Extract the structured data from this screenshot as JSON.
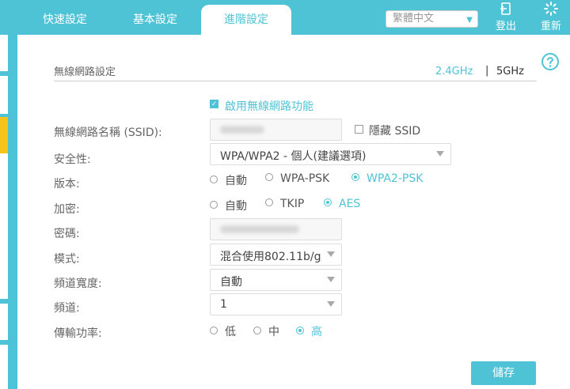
{
  "nav": {
    "tabs": [
      "快速設定",
      "基本設定",
      "進階設定"
    ],
    "language": "繁體中文",
    "logout": "登出",
    "reboot": "重新"
  },
  "section": {
    "title": "無線網路設定",
    "band_24": "2.4GHz",
    "band_sep": "|",
    "band_5": "5GHz"
  },
  "form": {
    "enable_wireless": "啟用無線網路功能",
    "ssid_label": "無線網路名稱 (SSID):",
    "hide_ssid": "隱藏 SSID",
    "security_label": "安全性:",
    "security_value": "WPA/WPA2 - 個人(建議選項)",
    "version_label": "版本:",
    "version_options": [
      "自動",
      "WPA-PSK",
      "WPA2-PSK"
    ],
    "encryption_label": "加密:",
    "encryption_options": [
      "自動",
      "TKIP",
      "AES"
    ],
    "password_label": "密碼:",
    "mode_label": "模式:",
    "mode_value": "混合使用802.11b/g/n",
    "bandwidth_label": "頻道寬度:",
    "bandwidth_value": "自動",
    "channel_label": "頻道:",
    "channel_value": "1",
    "power_label": "傳輸功率:",
    "power_options": [
      "低",
      "中",
      "高"
    ],
    "save": "儲存"
  },
  "colors": {
    "accent": "#4ec3d6",
    "sidebar_highlight": "#f6c318"
  },
  "icons": [
    "logout-icon",
    "reboot-icon",
    "help-icon",
    "chevron-down-icon"
  ]
}
